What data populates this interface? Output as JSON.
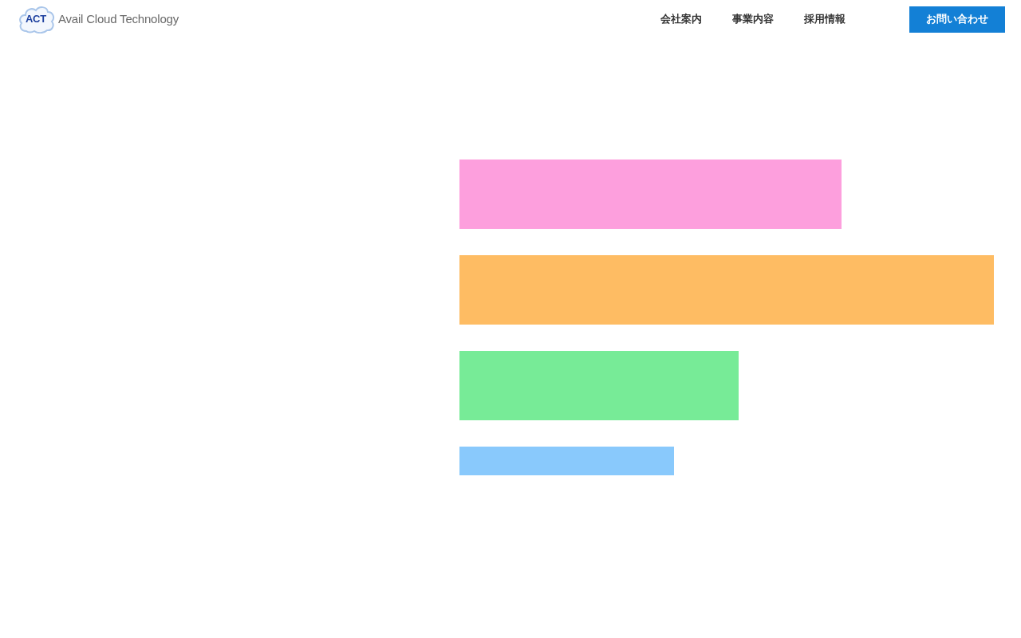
{
  "header": {
    "logo": {
      "initials": "ACT",
      "name": "Avail Cloud Technology"
    },
    "nav": [
      {
        "label": "会社案内"
      },
      {
        "label": "事業内容"
      },
      {
        "label": "採用情報"
      }
    ],
    "contact_button": "お問い合わせ"
  },
  "hero": {
    "blocks": [
      {
        "color": "#fd9fdd"
      },
      {
        "color": "#febc63"
      },
      {
        "color": "#77eb97"
      },
      {
        "color": "#89c9fc"
      }
    ]
  }
}
